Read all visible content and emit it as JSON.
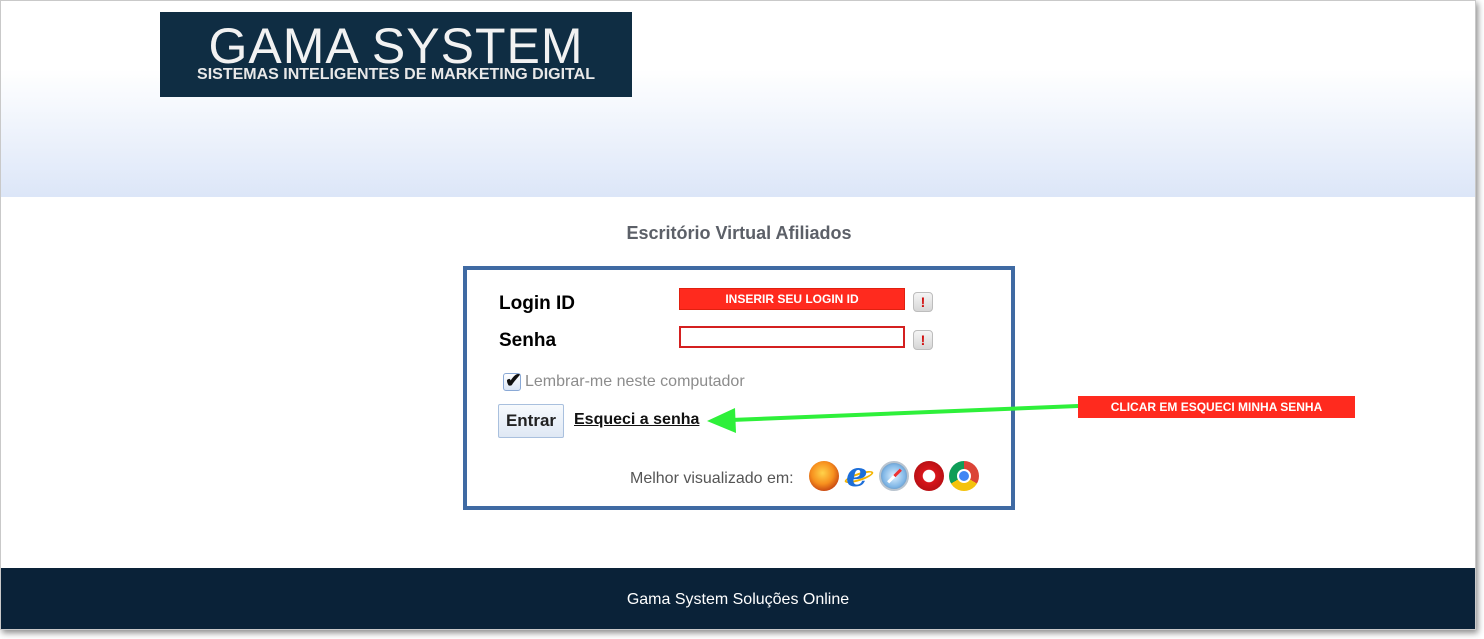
{
  "header": {
    "logo_title": "GAMA SYSTEM",
    "logo_subtitle": "SISTEMAS INTELIGENTES DE MARKETING DIGITAL"
  },
  "page": {
    "title": "Escritório Virtual Afiliados"
  },
  "login_form": {
    "login_label": "Login ID",
    "login_value": "INSERIR SEU LOGIN ID",
    "password_label": "Senha",
    "password_value": "",
    "warning_glyph": "!",
    "remember_label": "Lembrar-me neste computador",
    "remember_checked": true,
    "submit_label": "Entrar",
    "forgot_label": "Esqueci a senha",
    "best_viewed_label": "Melhor visualizado em:",
    "browsers": [
      "firefox-icon",
      "internet-explorer-icon",
      "safari-icon",
      "opera-icon",
      "chrome-icon"
    ]
  },
  "annotation": {
    "text": "CLICAR EM ESQUECI MINHA SENHA",
    "arrow_color": "#2ef03a"
  },
  "footer": {
    "text": "Gama System Soluções Online"
  },
  "colors": {
    "logo_bg": "#0f2d43",
    "box_border": "#3f6aa3",
    "alert_red": "#ff2a1e",
    "footer_bg": "#0a2238"
  }
}
